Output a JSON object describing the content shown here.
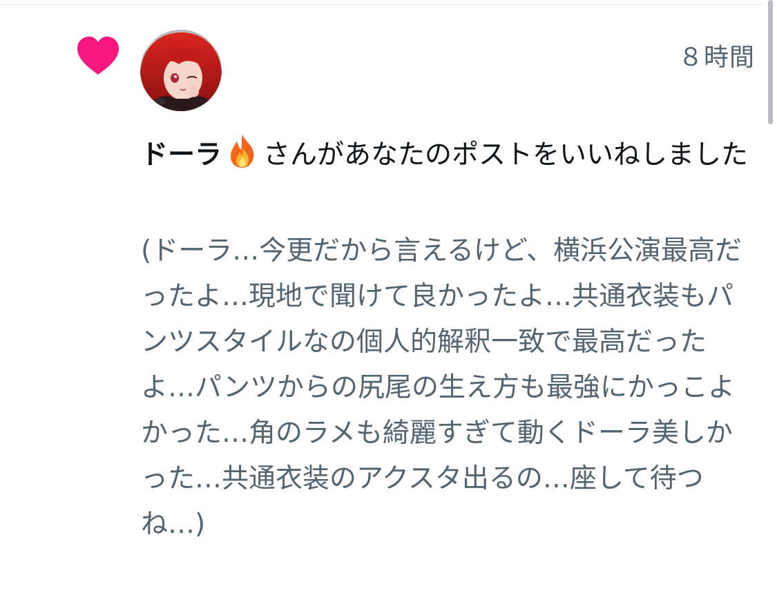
{
  "notification": {
    "time": "８時間",
    "actor_name": "ドーラ",
    "actor_emoji": "fire-emoji",
    "action_text": "さんがあなたのポストをいいねしました",
    "post_text": "(ドーラ…今更だから言えるけど、横浜公演最高だったよ…現地で聞けて良かったよ…共通衣装もパンツスタイルなの個人的解釈一致で最高だったよ…パンツからの尻尾の生え方も最強にかっこよかった…角のラメも綺麗すぎて動くドーラ美しかった…共通衣装のアクスタ出るの…座して待つね…)",
    "icon": "heart-icon",
    "avatar": "user-avatar"
  },
  "colors": {
    "like_pink": "#f91880",
    "secondary_text": "#536471",
    "primary_text": "#0f1419"
  }
}
